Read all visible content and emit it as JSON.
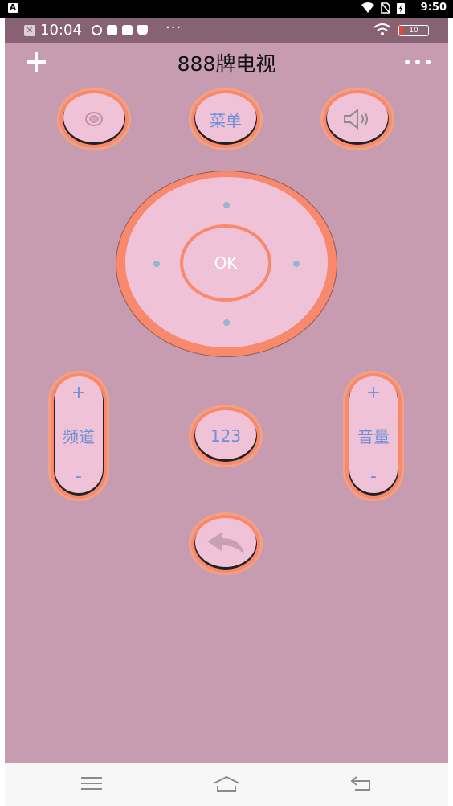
{
  "outer_status": {
    "time": "9:50",
    "badge": "A"
  },
  "inner_status": {
    "time": "10:04",
    "dots": "···",
    "battery": "10"
  },
  "header": {
    "title": "888牌电视"
  },
  "buttons": {
    "menu": "菜单",
    "ok": "OK",
    "numbers": "123",
    "channel": {
      "label": "频道",
      "plus": "+",
      "minus": "-"
    },
    "volume": {
      "label": "音量",
      "plus": "+",
      "minus": "-"
    }
  },
  "icons": [
    "plus-icon",
    "more-icon",
    "power-icon",
    "speaker-icon",
    "back-arrow-icon",
    "menu-lines-icon",
    "home-icon",
    "back-icon"
  ],
  "colors": {
    "background": "#c79cb0",
    "button_fill": "#f0c2d8",
    "button_ring": "#f8896d",
    "label": "#6c8fd8"
  }
}
